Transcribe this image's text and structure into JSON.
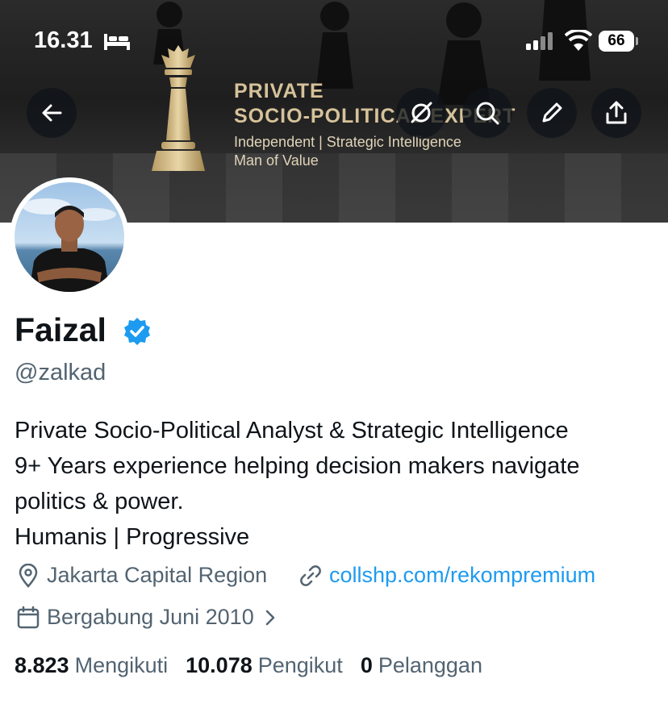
{
  "status_bar": {
    "time": "16.31",
    "battery": "66"
  },
  "banner": {
    "title_line1": "PRIVATE",
    "title_line2": "SOCIO-POLITICAL EXPERT",
    "subtitle_line1": "Independent | Strategic Intelligence",
    "subtitle_line2": "Man of Value"
  },
  "header_actions": [
    "back-icon",
    "grok-icon",
    "search-icon",
    "edit-icon",
    "share-icon"
  ],
  "profile": {
    "name": "Faizal",
    "handle": "@zalkad",
    "bio": [
      "Private Socio-Political Analyst & Strategic Intelligence",
      "9+ Years experience helping decision makers navigate",
      "politics & power.",
      "Humanis | Progressive"
    ],
    "location": "Jakarta Capital Region",
    "website": "collshp.com/rekompremium",
    "joined": "Bergabung Juni 2010"
  },
  "stats": {
    "following_count": "8.823",
    "following_label": "Mengikuti",
    "followers_count": "10.078",
    "followers_label": "Pengikut",
    "subscribers_count": "0",
    "subscribers_label": "Pelanggan"
  },
  "colors": {
    "accent": "#1d9bf0",
    "secondary_text": "#536471",
    "banner_gold": "#d6c29a"
  }
}
